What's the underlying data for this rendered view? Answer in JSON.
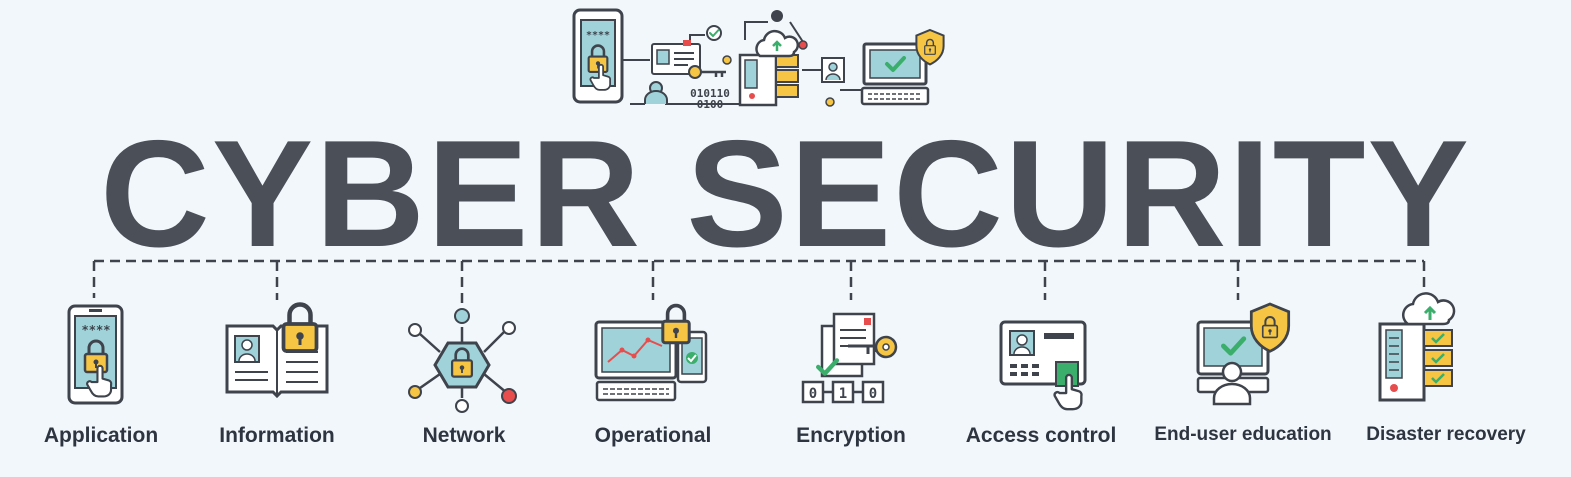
{
  "title": "CYBER SECURITY",
  "top_binary": [
    "010110",
    "0100"
  ],
  "encryption_bits": [
    "0",
    "1",
    "0"
  ],
  "app_pin": "****",
  "categories": [
    {
      "label": "Application",
      "icon": "smartphone-lock-icon"
    },
    {
      "label": "Information",
      "icon": "id-book-lock-icon"
    },
    {
      "label": "Network",
      "icon": "network-lock-icon"
    },
    {
      "label": "Operational",
      "icon": "monitor-chart-lock-icon"
    },
    {
      "label": "Encryption",
      "icon": "document-key-icon"
    },
    {
      "label": "Access control",
      "icon": "id-card-fingerprint-icon"
    },
    {
      "label": "End-user education",
      "icon": "user-monitor-shield-icon"
    },
    {
      "label": "Disaster recovery",
      "icon": "server-cloud-icon"
    }
  ],
  "colors": {
    "title": "#4a4f58",
    "outline": "#3e434c",
    "screen": "#9fd3d9",
    "lock": "#f5c543",
    "check": "#3cae6b",
    "alert": "#e84d4d",
    "background": "#f2f7fb"
  }
}
